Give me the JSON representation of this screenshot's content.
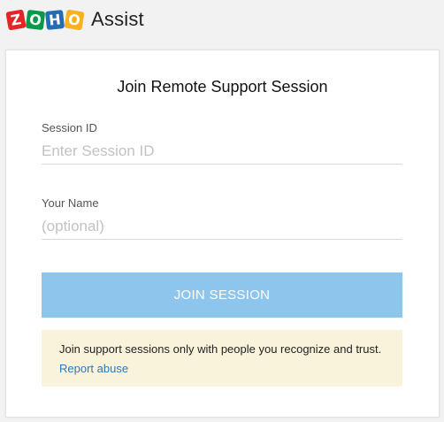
{
  "brand": {
    "logo_letters": [
      "Z",
      "O",
      "H",
      "O"
    ],
    "logo_colors": [
      "#e42527",
      "#089949",
      "#226db4",
      "#f9b21d"
    ],
    "name": "Assist"
  },
  "form": {
    "title": "Join Remote Support Session",
    "session_id": {
      "label": "Session ID",
      "placeholder": "Enter Session ID",
      "value": ""
    },
    "your_name": {
      "label": "Your Name",
      "placeholder": "(optional)",
      "value": ""
    },
    "join_button_label": "JOIN SESSION",
    "join_button_color": "#8ec5ec"
  },
  "notice": {
    "text": "Join support sessions only with people you recognize and trust.",
    "link_text": "Report abuse",
    "background": "#faf3dc"
  }
}
